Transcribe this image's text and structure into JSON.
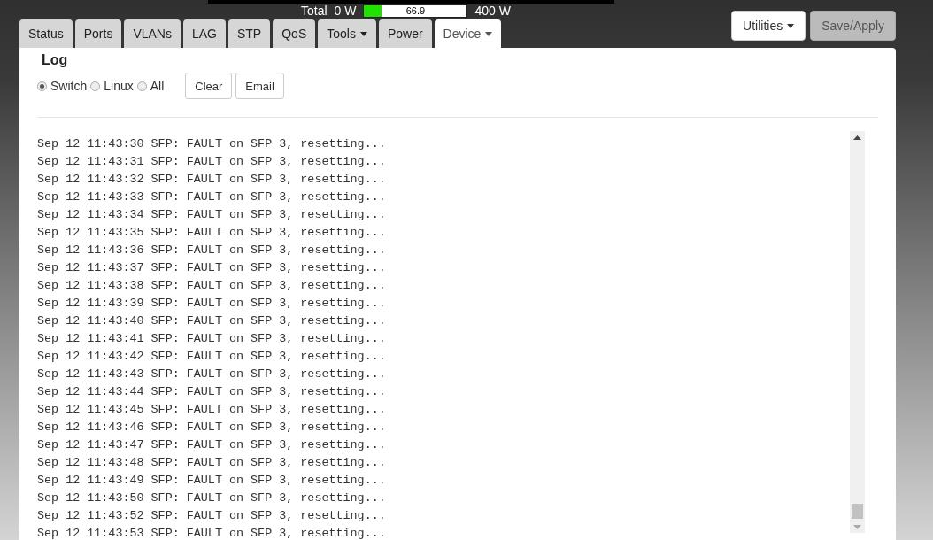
{
  "power": {
    "label": "Total",
    "min": "0 W",
    "max": "400 W",
    "reading": "66.9",
    "level": 0.167
  },
  "tabs": [
    {
      "label": "Status",
      "selected": false,
      "dropdown": false
    },
    {
      "label": "Ports",
      "selected": false,
      "dropdown": false
    },
    {
      "label": "VLANs",
      "selected": false,
      "dropdown": false
    },
    {
      "label": "LAG",
      "selected": false,
      "dropdown": false
    },
    {
      "label": "STP",
      "selected": false,
      "dropdown": false
    },
    {
      "label": "QoS",
      "selected": false,
      "dropdown": false
    },
    {
      "label": "Tools",
      "selected": false,
      "dropdown": true
    },
    {
      "label": "Power",
      "selected": false,
      "dropdown": false
    },
    {
      "label": "Device",
      "selected": true,
      "dropdown": true
    }
  ],
  "actions": [
    {
      "label": "Utilities",
      "dropdown": true,
      "disabled": false
    },
    {
      "label": "Save/Apply",
      "dropdown": false,
      "disabled": true
    }
  ],
  "log": {
    "title": "Log",
    "sources": [
      {
        "label": "Switch",
        "selected": true
      },
      {
        "label": "Linux",
        "selected": false
      },
      {
        "label": "All",
        "selected": false
      }
    ],
    "buttons": [
      "Clear",
      "Email"
    ],
    "lines": [
      "Sep 12 11:43:30 SFP: FAULT on SFP 3, resetting...",
      "Sep 12 11:43:31 SFP: FAULT on SFP 3, resetting...",
      "Sep 12 11:43:32 SFP: FAULT on SFP 3, resetting...",
      "Sep 12 11:43:33 SFP: FAULT on SFP 3, resetting...",
      "Sep 12 11:43:34 SFP: FAULT on SFP 3, resetting...",
      "Sep 12 11:43:35 SFP: FAULT on SFP 3, resetting...",
      "Sep 12 11:43:36 SFP: FAULT on SFP 3, resetting...",
      "Sep 12 11:43:37 SFP: FAULT on SFP 3, resetting...",
      "Sep 12 11:43:38 SFP: FAULT on SFP 3, resetting...",
      "Sep 12 11:43:39 SFP: FAULT on SFP 3, resetting...",
      "Sep 12 11:43:40 SFP: FAULT on SFP 3, resetting...",
      "Sep 12 11:43:41 SFP: FAULT on SFP 3, resetting...",
      "Sep 12 11:43:42 SFP: FAULT on SFP 3, resetting...",
      "Sep 12 11:43:43 SFP: FAULT on SFP 3, resetting...",
      "Sep 12 11:43:44 SFP: FAULT on SFP 3, resetting...",
      "Sep 12 11:43:45 SFP: FAULT on SFP 3, resetting...",
      "Sep 12 11:43:46 SFP: FAULT on SFP 3, resetting...",
      "Sep 12 11:43:47 SFP: FAULT on SFP 3, resetting...",
      "Sep 12 11:43:48 SFP: FAULT on SFP 3, resetting...",
      "Sep 12 11:43:49 SFP: FAULT on SFP 3, resetting...",
      "Sep 12 11:43:50 SFP: FAULT on SFP 3, resetting...",
      "Sep 12 11:43:52 SFP: FAULT on SFP 3, resetting...",
      "Sep 12 11:43:53 SFP: FAULT on SFP 3, resetting..."
    ]
  }
}
